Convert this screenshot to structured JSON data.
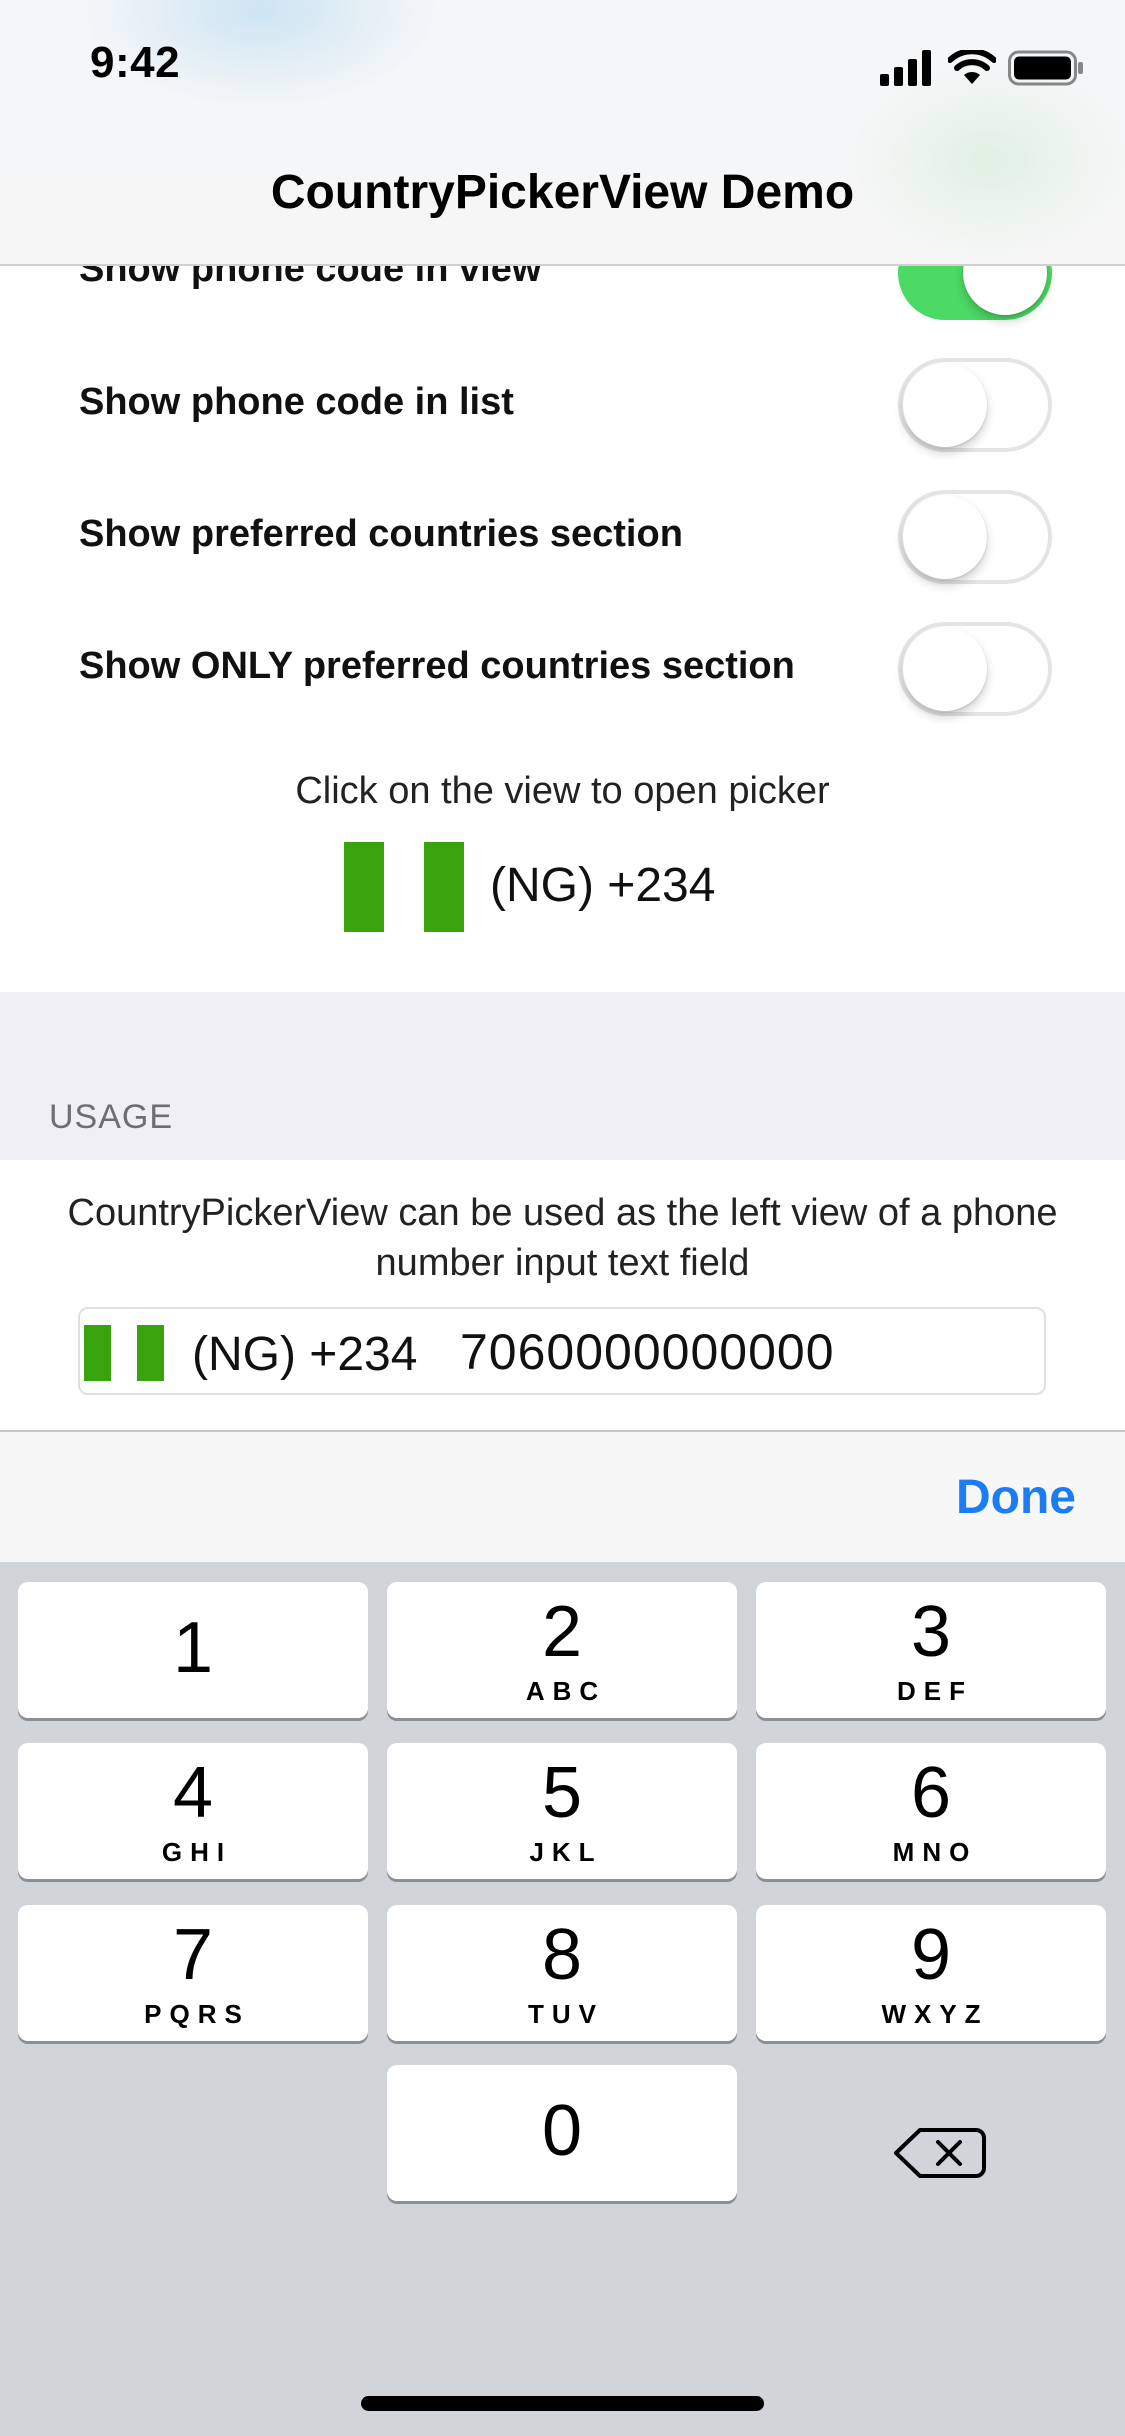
{
  "status_bar": {
    "time": "9:42"
  },
  "nav": {
    "title": "CountryPickerView Demo"
  },
  "settings": [
    {
      "label": "Show phone code in view",
      "on": true
    },
    {
      "label": "Show phone code in list",
      "on": false
    },
    {
      "label": "Show preferred countries section",
      "on": false
    },
    {
      "label": "Show ONLY preferred countries section",
      "on": false
    }
  ],
  "picker": {
    "hint": "Click on the view to open picker",
    "code": "(NG) +234"
  },
  "usage": {
    "header": "USAGE",
    "description": "CountryPickerView can be used as the left view of a phone number input text field",
    "field_code": "(NG) +234",
    "phone_number": "7060000000000"
  },
  "toolbar": {
    "done_label": "Done"
  },
  "keypad": [
    {
      "digit": "1",
      "letters": ""
    },
    {
      "digit": "2",
      "letters": "ABC"
    },
    {
      "digit": "3",
      "letters": "DEF"
    },
    {
      "digit": "4",
      "letters": "GHI"
    },
    {
      "digit": "5",
      "letters": "JKL"
    },
    {
      "digit": "6",
      "letters": "MNO"
    },
    {
      "digit": "7",
      "letters": "PQRS"
    },
    {
      "digit": "8",
      "letters": "TUV"
    },
    {
      "digit": "9",
      "letters": "WXYZ"
    },
    {
      "digit": "0",
      "letters": ""
    }
  ],
  "colors": {
    "accent": "#1b7cf3",
    "switch_on": "#4cd964",
    "flag_green": "#38a30d"
  },
  "icons": [
    "signal-icon",
    "wifi-icon",
    "battery-icon",
    "delete-icon"
  ]
}
